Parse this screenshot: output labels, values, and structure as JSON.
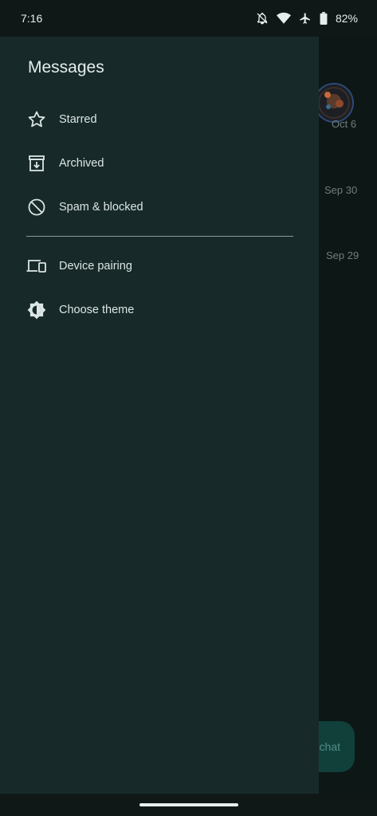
{
  "status_bar": {
    "time": "7:16",
    "battery_percent": "82%",
    "icons": [
      "notifications-off-icon",
      "wifi-icon",
      "airplane-icon",
      "battery-icon"
    ]
  },
  "drawer": {
    "title": "Messages",
    "primary_items": [
      {
        "label": "Starred",
        "icon": "star-icon"
      },
      {
        "label": "Archived",
        "icon": "archive-icon"
      },
      {
        "label": "Spam & blocked",
        "icon": "block-icon"
      }
    ],
    "secondary_items": [
      {
        "label": "Device pairing",
        "icon": "devices-icon"
      },
      {
        "label": "Choose theme",
        "icon": "theme-icon"
      }
    ]
  },
  "background": {
    "dates": [
      "Oct 6",
      "Sep 30",
      "Sep 29"
    ],
    "fab_label": "chat"
  },
  "colors": {
    "drawer_bg": "#172a29",
    "status_bg": "#101817",
    "text": "#dbe6e4",
    "fab_bg": "#11403b"
  }
}
